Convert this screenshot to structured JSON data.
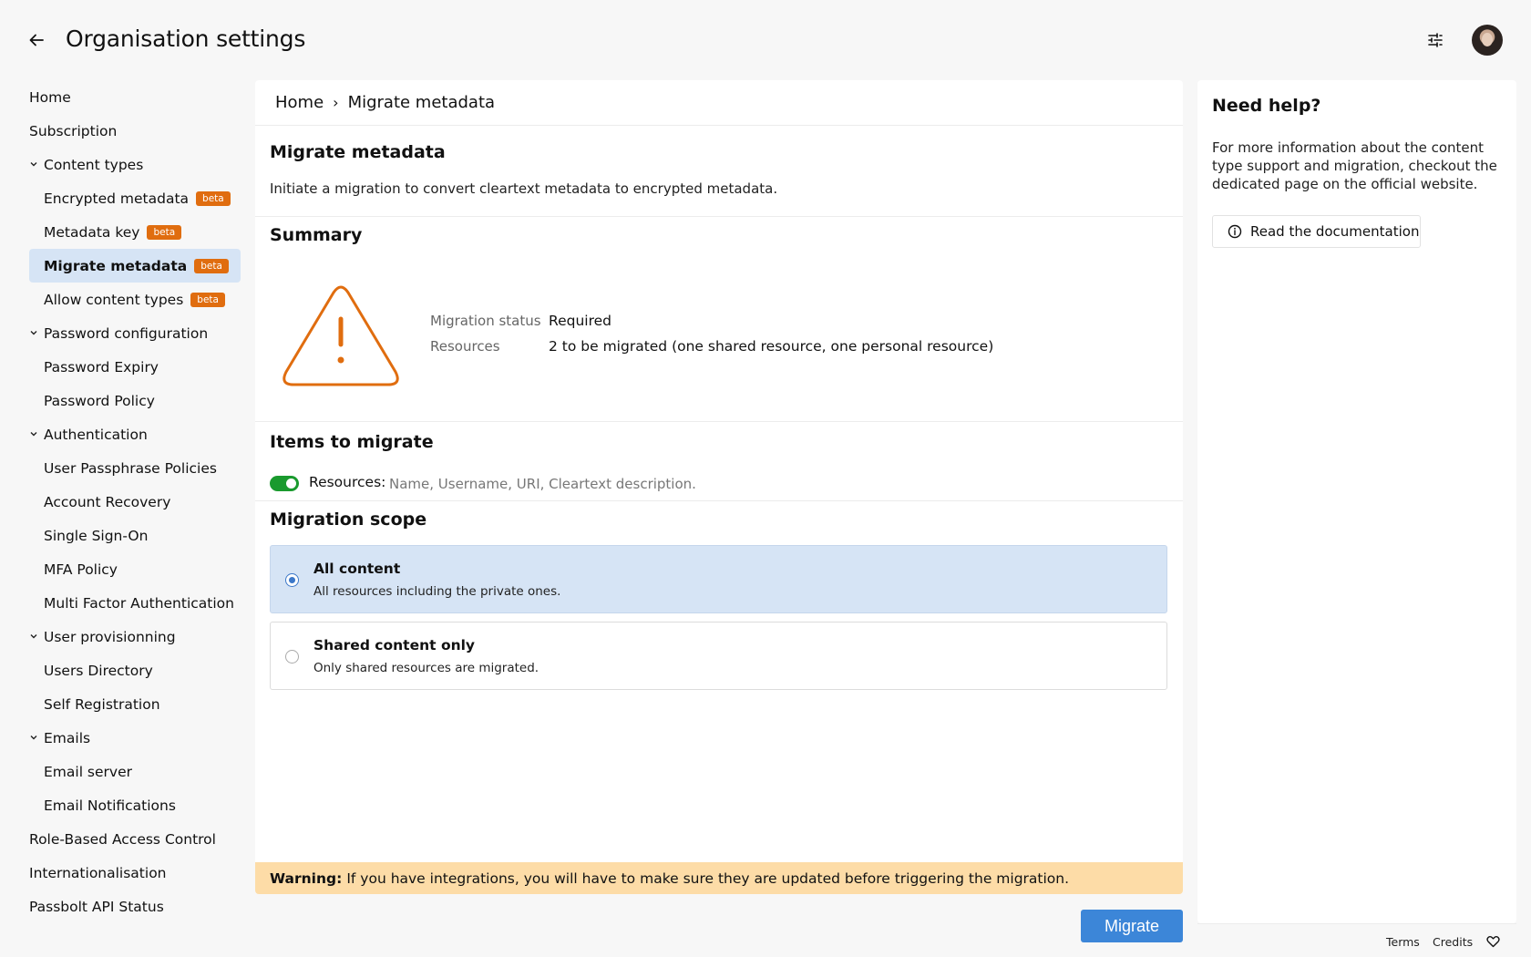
{
  "header": {
    "title": "Organisation settings",
    "back_icon": "arrow-left-icon",
    "filter_icon": "sliders-icon"
  },
  "sidebar": {
    "items": [
      {
        "label": "Home",
        "level": 0
      },
      {
        "label": "Subscription",
        "level": 0
      },
      {
        "label": "Content types",
        "level": 0,
        "expanded": true
      },
      {
        "label": "Encrypted metadata",
        "level": 1,
        "badge": "beta"
      },
      {
        "label": "Metadata key",
        "level": 1,
        "badge": "beta"
      },
      {
        "label": "Migrate metadata",
        "level": 1,
        "badge": "beta",
        "active": true
      },
      {
        "label": "Allow content types",
        "level": 1,
        "badge": "beta"
      },
      {
        "label": "Password configuration",
        "level": 0,
        "expanded": true
      },
      {
        "label": "Password Expiry",
        "level": 1
      },
      {
        "label": "Password Policy",
        "level": 1
      },
      {
        "label": "Authentication",
        "level": 0,
        "expanded": true
      },
      {
        "label": "User Passphrase Policies",
        "level": 1
      },
      {
        "label": "Account Recovery",
        "level": 1
      },
      {
        "label": "Single Sign-On",
        "level": 1
      },
      {
        "label": "MFA Policy",
        "level": 1
      },
      {
        "label": "Multi Factor Authentication",
        "level": 1
      },
      {
        "label": "User provisionning",
        "level": 0,
        "expanded": true
      },
      {
        "label": "Users Directory",
        "level": 1
      },
      {
        "label": "Self Registration",
        "level": 1
      },
      {
        "label": "Emails",
        "level": 0,
        "expanded": true
      },
      {
        "label": "Email server",
        "level": 1
      },
      {
        "label": "Email Notifications",
        "level": 1
      },
      {
        "label": "Role-Based Access Control",
        "level": 0
      },
      {
        "label": "Internationalisation",
        "level": 0
      },
      {
        "label": "Passbolt API Status",
        "level": 0
      }
    ]
  },
  "breadcrumb": {
    "home": "Home",
    "separator": "›",
    "current": "Migrate metadata"
  },
  "main": {
    "title": "Migrate metadata",
    "intro": "Initiate a migration to convert cleartext metadata to encrypted metadata.",
    "summary": {
      "title": "Summary",
      "status_label": "Migration status",
      "status_value": "Required",
      "resources_label": "Resources",
      "resources_value": "2 to be migrated (one shared resource, one personal resource)",
      "icon": "warning-triangle-icon"
    },
    "items": {
      "title": "Items to migrate",
      "toggle_on": true,
      "label": "Resources:",
      "description": "Name, Username, URI, Cleartext description."
    },
    "scope": {
      "title": "Migration scope",
      "options": [
        {
          "title": "All content",
          "desc": "All resources including the private ones.",
          "selected": true
        },
        {
          "title": "Shared content only",
          "desc": "Only shared resources are migrated.",
          "selected": false
        }
      ]
    },
    "warning": {
      "label": "Warning:",
      "text": "If you have integrations, you will have to make sure they are updated before triggering the migration."
    },
    "migrate_button": "Migrate"
  },
  "help": {
    "title": "Need help?",
    "text": "For more information about the content type support and migration, checkout the dedicated page on the official website.",
    "button": "Read the documentation",
    "button_icon": "info-circle-icon"
  },
  "footer": {
    "terms": "Terms",
    "credits": "Credits",
    "heart_icon": "heart-icon"
  },
  "colors": {
    "accent": "#3c86d8",
    "warning": "#e06d0f",
    "warning_bg": "#fddca7",
    "selected_bg": "#d6e4f5",
    "toggle_on": "#1a9a2e"
  }
}
